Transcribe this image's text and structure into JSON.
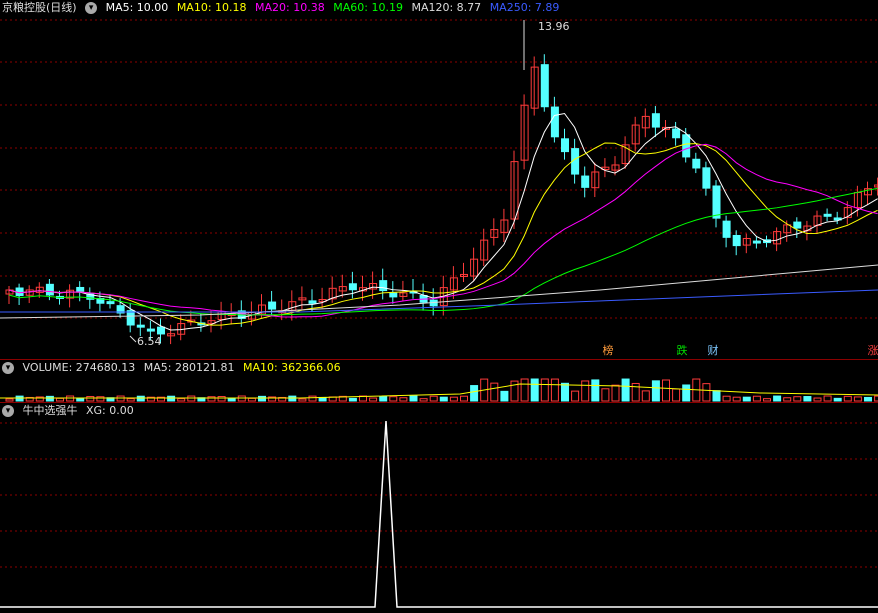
{
  "main": {
    "title": "京粮控股(日线)",
    "ma": [
      {
        "label": "MA5: 10.00",
        "color": "#ffffff"
      },
      {
        "label": "MA10: 10.18",
        "color": "#ffff00"
      },
      {
        "label": "MA20: 10.38",
        "color": "#ff00ff"
      },
      {
        "label": "MA60: 10.19",
        "color": "#00ff00"
      },
      {
        "label": "MA120: 8.77",
        "color": "#dddddd"
      },
      {
        "label": "MA250: 7.89",
        "color": "#3a5bff"
      }
    ],
    "high_label": "13.96",
    "low_label": "6.54",
    "flags": [
      {
        "text": "榜",
        "color": "#ff9b3b"
      },
      {
        "text": "跌",
        "color": "#00e000"
      },
      {
        "text": "财",
        "color": "#7ec8ff"
      },
      {
        "text": "涨",
        "color": "#ff4040"
      }
    ]
  },
  "volume": {
    "items": [
      {
        "label": "VOLUME: 274680.13",
        "color": "#dddddd"
      },
      {
        "label": "MA5: 280121.81",
        "color": "#dddddd"
      },
      {
        "label": "MA10: 362366.06",
        "color": "#ffff00"
      }
    ]
  },
  "indicator": {
    "items": [
      {
        "label": "牛中选强牛",
        "color": "#dddddd"
      },
      {
        "label": "XG: 0.00",
        "color": "#dddddd"
      }
    ]
  },
  "colors": {
    "up": "#ff3b3b",
    "down": "#54ffff",
    "grid": "#8b0000"
  }
}
